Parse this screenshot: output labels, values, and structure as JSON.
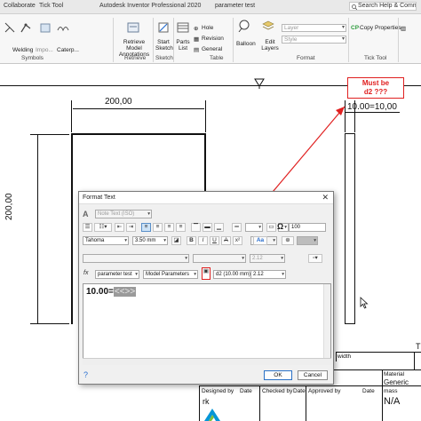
{
  "app": {
    "window_title": "Autodesk Inventor Professional 2020",
    "document_name": "parameter test",
    "search_placeholder": "Search Help & Commands..."
  },
  "ribbon": {
    "tabs": [
      "Collaborate",
      "Tick Tool"
    ],
    "symbols_items": [
      "Welding",
      "Impo...",
      "Caterp..."
    ],
    "symbols_label": "Symbols",
    "retrieve_button": "Retrieve Model Annotations",
    "retrieve_label": "Retrieve",
    "start_sketch": "Start Sketch",
    "sketch_label": "Sketch",
    "parts_list": "Parts List",
    "hole": "Hole",
    "revision": "Revision",
    "general": "General",
    "table_label": "Table",
    "balloon": "Balloon",
    "edit_layers": "Edit Layers",
    "layer_placeholder": "Layer",
    "style_placeholder": "Style",
    "format_label": "Format",
    "copy_properties": "Copy Properties",
    "tick_tool_label": "Tick Tool"
  },
  "drawing": {
    "dim_horizontal": "200,00",
    "dim_vertical": "200,00",
    "dim_right": "10.00=10,00",
    "note_line1": "Must be",
    "note_line2": "d2 ???"
  },
  "dialog": {
    "title": "Format Text",
    "style_value": "Note Text (ISO)",
    "font_value": "Tahoma",
    "size_value": "3.50 mm",
    "width_value": "100",
    "precision_value_disabled": "2.12",
    "component_value": "parameter test",
    "source_value": "Model Parameters",
    "parameter_value": "d2 (10.00 mm)",
    "precision_value": "2.12",
    "editor_text": "10.00=",
    "editor_field": "<<>>",
    "ok_label": "OK",
    "cancel_label": "Cancel",
    "bold_label": "B",
    "italic_label": "I",
    "underline_label": "U",
    "strike_label": "A",
    "fx_label": "fx"
  },
  "title_block": {
    "width_label": "width",
    "material_label": "Material",
    "material_value": "Generic",
    "mass_label": "mass",
    "mass_value": "N/A",
    "designed_by_label": "Designed by",
    "designed_by_value": "rk",
    "checked_by_label": "Checked by",
    "approved_by_label": "Approved by",
    "date_label": "Date",
    "date_label2": "Date",
    "date_label3": "Date",
    "edge_letter": "T"
  },
  "colors": {
    "annotation_red": "#e02020",
    "ribbon_bg": "#f7f7f7",
    "dialog_bg": "#f0f0f0",
    "selection_blue": "#cde3f7"
  }
}
